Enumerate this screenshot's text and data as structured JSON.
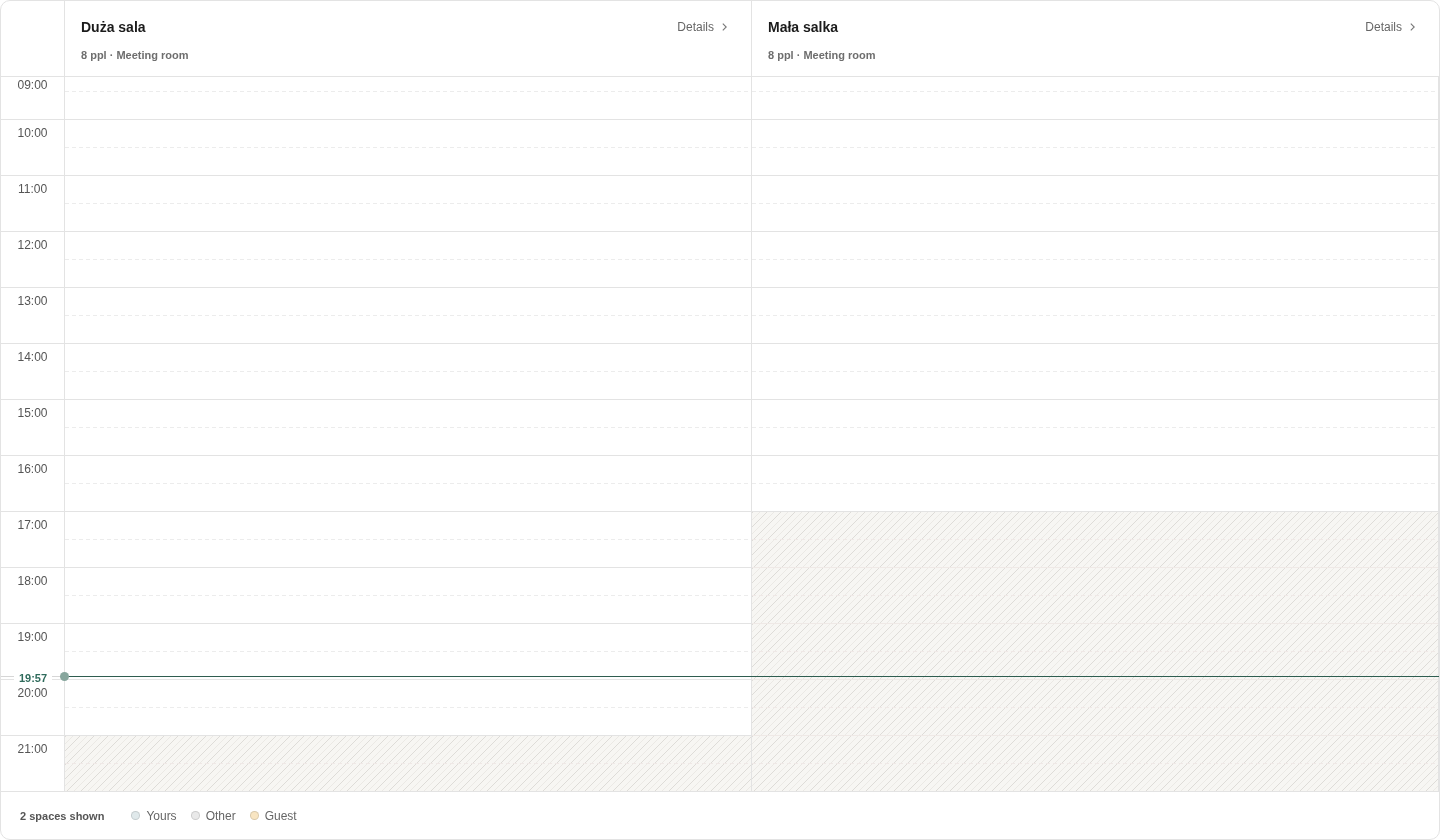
{
  "rooms": [
    {
      "name": "Duża sala",
      "meta": "8 ppl · Meeting room",
      "details": "Details",
      "slots": [
        {
          "unavailable": false
        },
        {
          "unavailable": false
        },
        {
          "unavailable": false
        },
        {
          "unavailable": false
        },
        {
          "unavailable": false
        },
        {
          "unavailable": false
        },
        {
          "unavailable": false
        },
        {
          "unavailable": false
        },
        {
          "unavailable": false
        },
        {
          "unavailable": false
        },
        {
          "unavailable": false
        },
        {
          "unavailable": false
        },
        {
          "unavailable": true
        }
      ]
    },
    {
      "name": "Mała salka",
      "meta": "8 ppl · Meeting room",
      "details": "Details",
      "slots": [
        {
          "unavailable": false
        },
        {
          "unavailable": false
        },
        {
          "unavailable": false
        },
        {
          "unavailable": false
        },
        {
          "unavailable": false
        },
        {
          "unavailable": false
        },
        {
          "unavailable": false
        },
        {
          "unavailable": false
        },
        {
          "unavailable": true
        },
        {
          "unavailable": true
        },
        {
          "unavailable": true
        },
        {
          "unavailable": true
        },
        {
          "unavailable": true
        }
      ]
    }
  ],
  "hours": [
    "09:00",
    "10:00",
    "11:00",
    "12:00",
    "13:00",
    "14:00",
    "15:00",
    "16:00",
    "17:00",
    "18:00",
    "19:00",
    "20:00",
    "21:00"
  ],
  "now": {
    "label": "19:57"
  },
  "footer": {
    "summary": "2 spaces shown",
    "legend": [
      {
        "label": "Yours",
        "color": "#e0e9eb"
      },
      {
        "label": "Other",
        "color": "#e9e9e9"
      },
      {
        "label": "Guest",
        "color": "#f8e5c2"
      }
    ]
  }
}
